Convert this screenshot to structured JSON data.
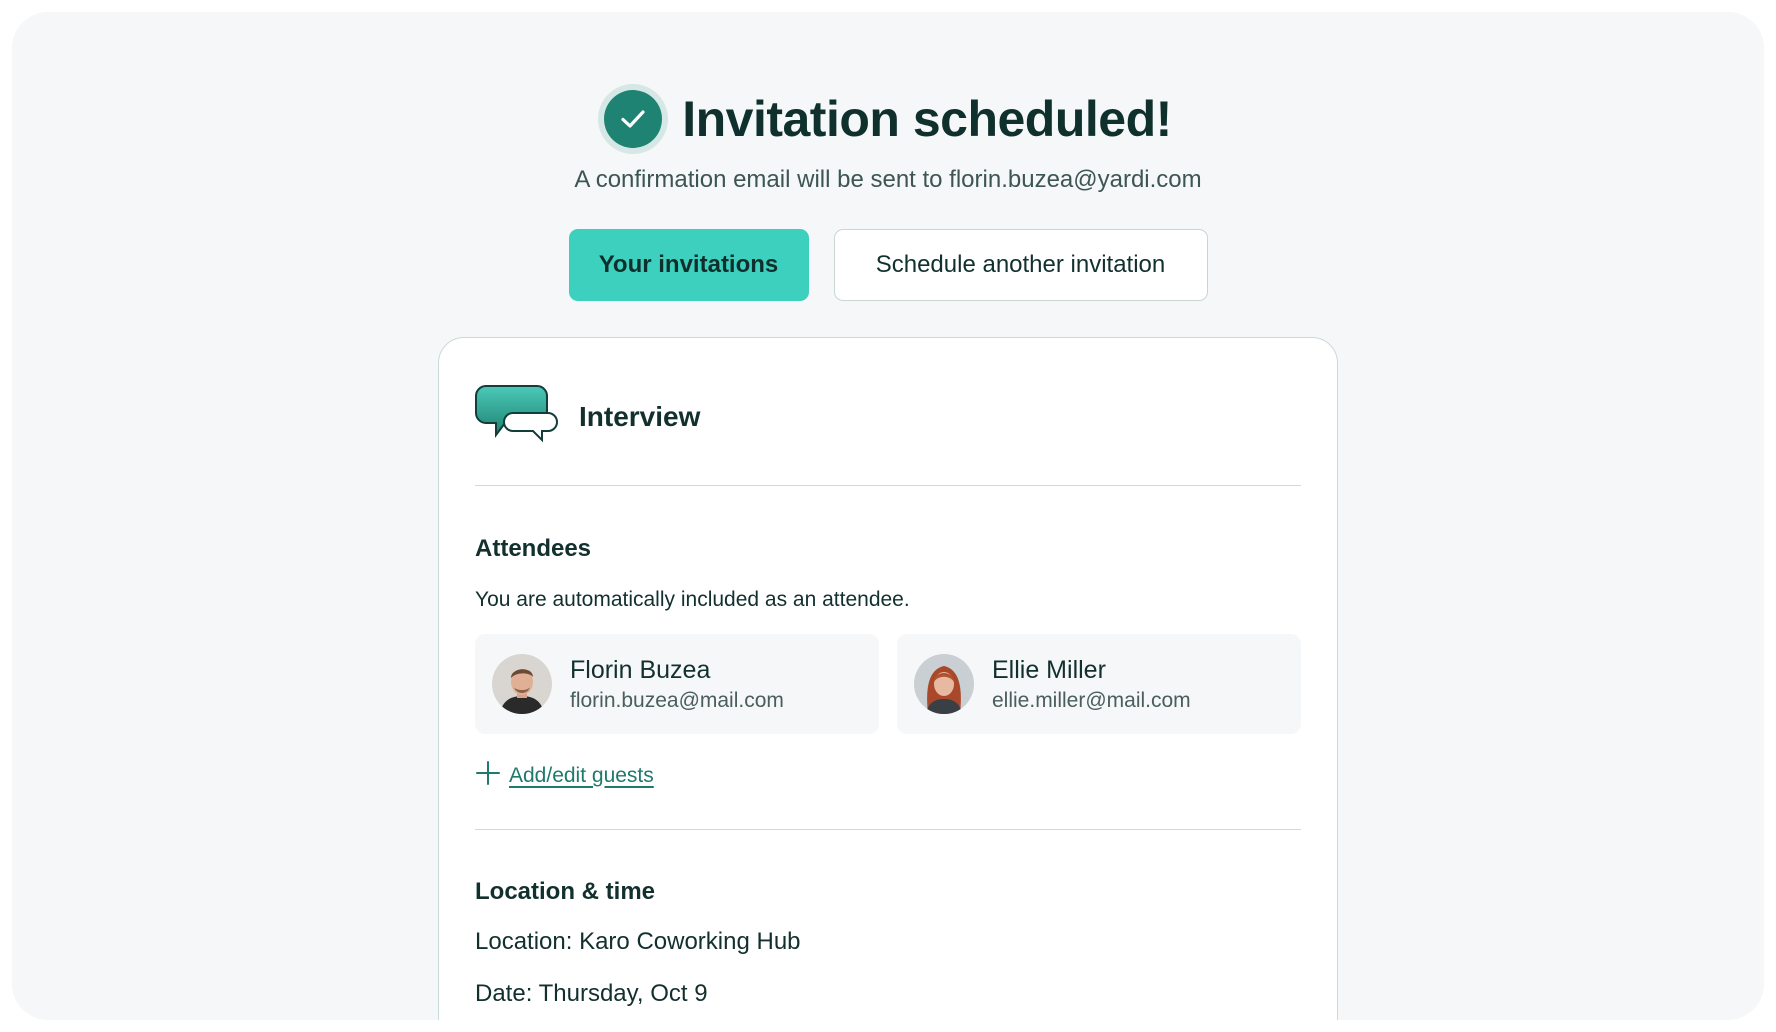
{
  "header": {
    "title": "Invitation scheduled!",
    "subtitle": "A confirmation email will be sent to florin.buzea@yardi.com",
    "icon": "check-circle-icon",
    "accent_color": "#1f8374"
  },
  "actions": {
    "primary_label": "Your invitations",
    "secondary_label": "Schedule another invitation",
    "primary_color": "#3ed0bf"
  },
  "card": {
    "event_type": "Interview",
    "event_icon": "chat-bubbles-icon",
    "attendees": {
      "title": "Attendees",
      "note": "You are automatically included as an attendee.",
      "people": [
        {
          "name": "Florin Buzea",
          "email": "florin.buzea@mail.com"
        },
        {
          "name": "Ellie Miller",
          "email": "ellie.miller@mail.com"
        }
      ],
      "add_label": "Add/edit guests"
    },
    "location_time": {
      "title": "Location & time",
      "location": "Location: Karo Coworking Hub",
      "date": "Date: Thursday, Oct 9"
    }
  }
}
